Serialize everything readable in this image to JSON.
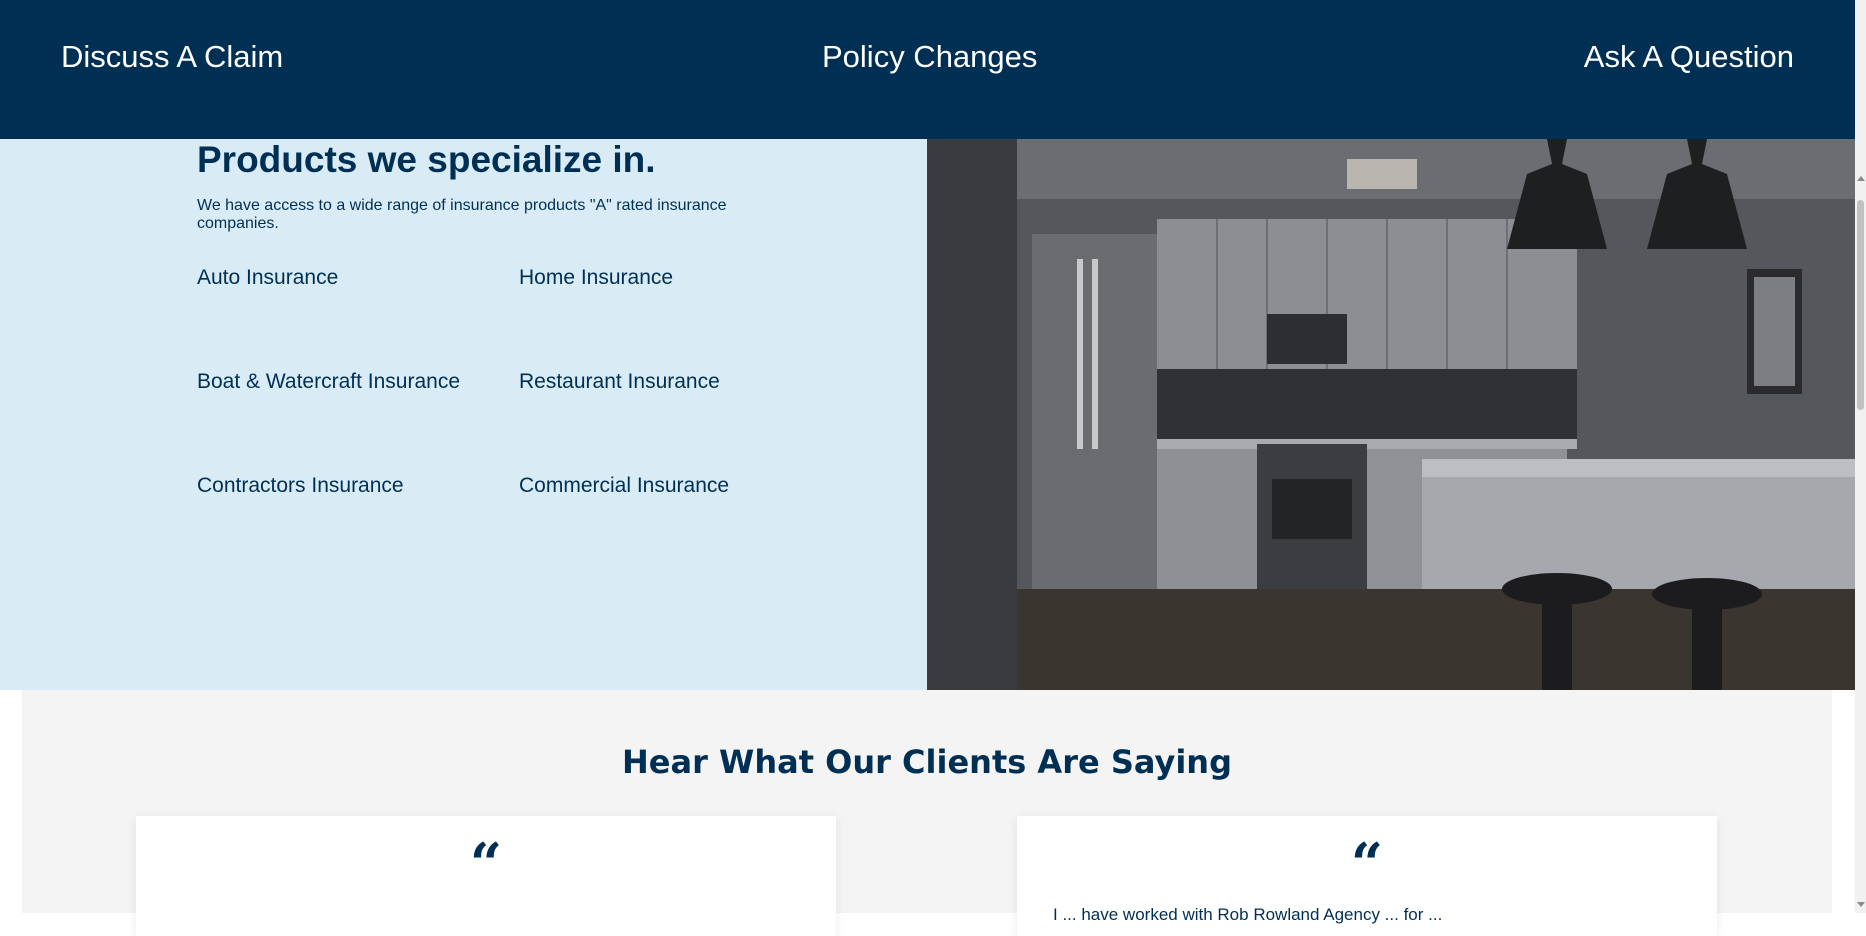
{
  "nav": {
    "discuss_claim": "Discuss A Claim",
    "policy_changes": "Policy Changes",
    "ask_question": "Ask A Question"
  },
  "products": {
    "title": "Products we specialize in.",
    "intro": "We have access to a wide range of insurance products \"A\" rated insurance companies.",
    "items": [
      "Auto Insurance",
      "Home Insurance",
      "Boat & Watercraft Insurance",
      "Restaurant Insurance",
      "Contractors Insurance",
      "Commercial Insurance"
    ]
  },
  "testimonials": {
    "title": "Hear What Our Clients Are Saying",
    "quote_mark": "“",
    "cards": [
      {
        "text": ""
      },
      {
        "text": "I ... have worked with Rob Rowland Agency ... for ..."
      }
    ]
  },
  "colors": {
    "navy": "#002f54",
    "light_blue": "#d9ecf6",
    "testimonial_bg": "#f4f4f4"
  }
}
